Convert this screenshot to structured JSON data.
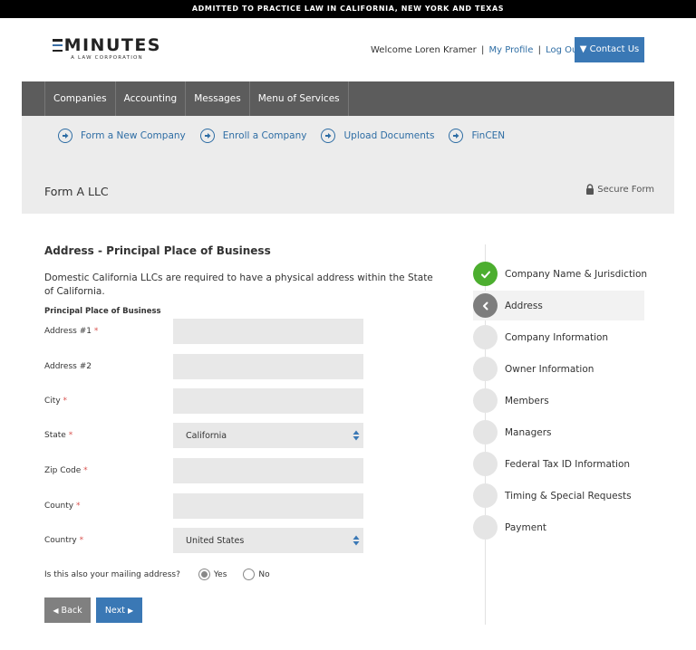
{
  "topbar": {
    "text": "ADMITTED TO PRACTICE LAW IN CALIFORNIA, NEW YORK AND TEXAS"
  },
  "header": {
    "logo_main": "MINUTES",
    "logo_sub": "A LAW CORPORATION",
    "welcome_text": "Welcome Loren Kramer",
    "my_profile": "My Profile",
    "log_out": "Log Out",
    "separator": "|",
    "contact_button": "▼ Contact Us"
  },
  "nav": {
    "items": [
      {
        "label": "Companies"
      },
      {
        "label": "Accounting"
      },
      {
        "label": "Messages"
      },
      {
        "label": "Menu of Services"
      }
    ]
  },
  "subnav": {
    "links": [
      {
        "label": "Form a New Company",
        "icon": "circle-arrow-right-icon"
      },
      {
        "label": "Enroll a Company",
        "icon": "circle-arrow-right-icon"
      },
      {
        "label": "Upload Documents",
        "icon": "circle-arrow-right-icon"
      },
      {
        "label": "FinCEN",
        "icon": "circle-arrow-right-icon"
      }
    ],
    "form_title": "Form A LLC",
    "secure_label": "Secure Form"
  },
  "form": {
    "section_title": "Address - Principal Place of Business",
    "description": "Domestic California LLCs are required to have a physical address within the State of California.",
    "subheading": "Principal Place of Business",
    "required_marker": "*",
    "fields": [
      {
        "label": "Address #1",
        "required": true,
        "type": "text",
        "value": ""
      },
      {
        "label": "Address #2",
        "required": false,
        "type": "text",
        "value": ""
      },
      {
        "label": "City",
        "required": true,
        "type": "text",
        "value": ""
      },
      {
        "label": "State",
        "required": true,
        "type": "select",
        "value": "California"
      },
      {
        "label": "Zip Code",
        "required": true,
        "type": "text",
        "value": ""
      },
      {
        "label": "County",
        "required": true,
        "type": "text",
        "value": ""
      },
      {
        "label": "Country",
        "required": true,
        "type": "select",
        "value": "United States"
      }
    ],
    "mailing_question": "Is this also your mailing address?",
    "mailing_options": [
      {
        "label": "Yes",
        "selected": true
      },
      {
        "label": "No",
        "selected": false
      }
    ],
    "back_label": "Back",
    "next_label": "Next"
  },
  "steps": {
    "items": [
      {
        "label": "Company Name & Jurisdiction",
        "status": "done"
      },
      {
        "label": "Address",
        "status": "current"
      },
      {
        "label": "Company Information",
        "status": "pending"
      },
      {
        "label": "Owner Information",
        "status": "pending"
      },
      {
        "label": "Members",
        "status": "pending"
      },
      {
        "label": "Managers",
        "status": "pending"
      },
      {
        "label": "Federal Tax ID Information",
        "status": "pending"
      },
      {
        "label": "Timing & Special Requests",
        "status": "pending"
      },
      {
        "label": "Payment",
        "status": "pending"
      }
    ]
  },
  "colors": {
    "brand_blue": "#3a78b5",
    "link_blue": "#2e6da4",
    "nav_gray": "#5c5c5c",
    "done_green": "#4cae2f",
    "required_red": "#d9534f"
  }
}
